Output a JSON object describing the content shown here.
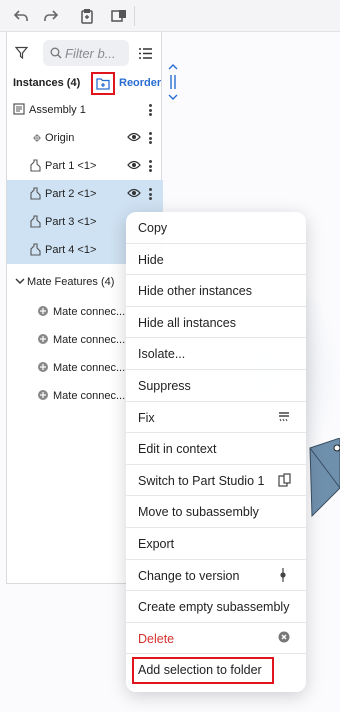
{
  "toolbar": {
    "buttons": [
      "undo-icon",
      "redo-icon",
      "copy-paste-icon",
      "part-studio-icon"
    ]
  },
  "panel": {
    "search": {
      "placeholder": "Filter b..."
    },
    "instances": {
      "title": "Instances (4)",
      "reorder_label": "Reorder"
    },
    "tree": [
      {
        "label": "Assembly 1",
        "icon": "assembly-icon",
        "selected": false,
        "eye": false
      },
      {
        "label": "Origin",
        "icon": "origin-icon",
        "selected": false,
        "eye": true
      },
      {
        "label": "Part 1 <1>",
        "icon": "part-icon",
        "selected": false,
        "eye": true
      },
      {
        "label": "Part 2 <1>",
        "icon": "part-icon",
        "selected": true,
        "eye": true
      },
      {
        "label": "Part 3 <1>",
        "icon": "part-icon",
        "selected": true,
        "eye": false
      },
      {
        "label": "Part 4 <1>",
        "icon": "part-icon",
        "selected": true,
        "eye": false
      }
    ],
    "mate_features": {
      "title": "Mate Features (4)",
      "items": [
        "Mate connec...",
        "Mate connec...",
        "Mate connec...",
        "Mate connec..."
      ]
    }
  },
  "context_menu": {
    "items": [
      {
        "label": "Copy",
        "icon": ""
      },
      {
        "label": "Hide",
        "icon": ""
      },
      {
        "label": "Hide other instances",
        "icon": ""
      },
      {
        "label": "Hide all instances",
        "icon": ""
      },
      {
        "label": "Isolate...",
        "icon": ""
      },
      {
        "label": "Suppress",
        "icon": ""
      },
      {
        "label": "Fix",
        "icon": "fix-icon"
      },
      {
        "label": "Edit in context",
        "icon": ""
      },
      {
        "label": "Switch to Part Studio 1",
        "icon": "part-studio-icon"
      },
      {
        "label": "Move to subassembly",
        "icon": ""
      },
      {
        "label": "Export",
        "icon": ""
      },
      {
        "label": "Change to version",
        "icon": "version-icon"
      },
      {
        "label": "Create empty subassembly",
        "icon": ""
      },
      {
        "label": "Delete",
        "icon": "delete-icon"
      },
      {
        "label": "Add selection to folder",
        "icon": ""
      }
    ]
  },
  "colors": {
    "accent": "#2a6dd1",
    "selection": "#cfe2f3",
    "highlight": "#e0141c",
    "danger": "#d6322e"
  }
}
